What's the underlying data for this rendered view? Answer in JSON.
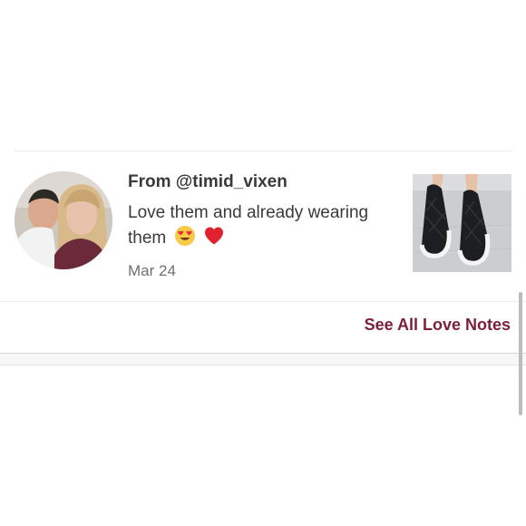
{
  "love_note": {
    "from_text": "From @timid_vixen",
    "message": "Love them and already wearing them",
    "emojis": [
      "heart-eyes-icon",
      "red-heart-icon"
    ],
    "date": "Mar 24"
  },
  "footer": {
    "see_all_label": "See All Love Notes"
  },
  "colors": {
    "accent": "#7b1f3a",
    "text": "#3a3a3a",
    "muted": "#707070",
    "divider": "#ebebeb"
  }
}
